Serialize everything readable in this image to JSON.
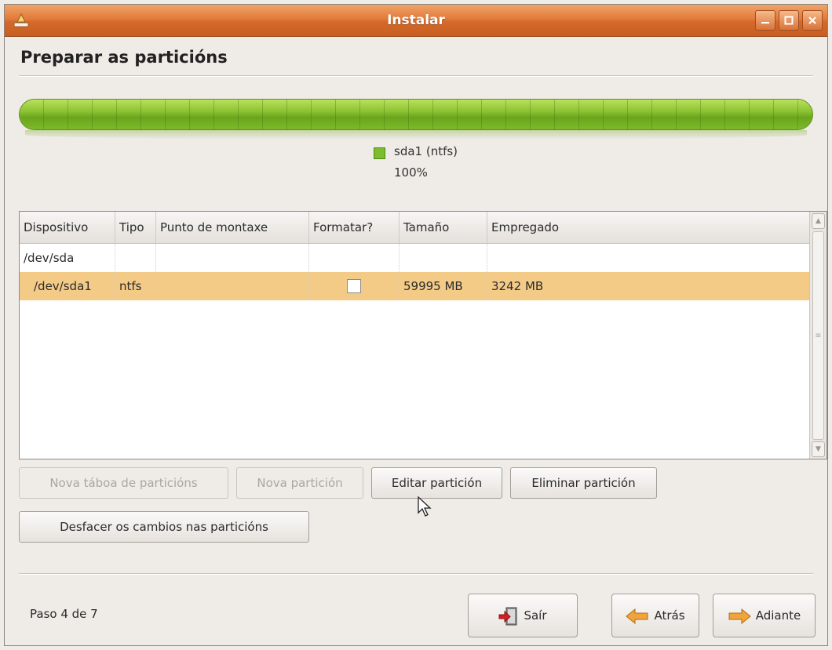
{
  "window": {
    "title": "Instalar",
    "controls": [
      "minimize",
      "maximize",
      "close"
    ],
    "accent_color": "#e27a3a"
  },
  "page": {
    "title": "Preparar as particións"
  },
  "partition_bar": {
    "fill_fraction": 1.0,
    "fill_color": "#7cbd2f",
    "legend": {
      "name": "sda1 (ntfs)",
      "percent": "100%"
    }
  },
  "table": {
    "columns": [
      "Dispositivo",
      "Tipo",
      "Punto de montaxe",
      "Formatar?",
      "Tamaño",
      "Empregado"
    ],
    "rows": [
      {
        "device": "/dev/sda",
        "type": "",
        "mount": "",
        "format": null,
        "size": "",
        "used": "",
        "selected": false
      },
      {
        "device": "/dev/sda1",
        "type": "ntfs",
        "mount": "",
        "format": false,
        "size": "59995 MB",
        "used": "3242 MB",
        "selected": true
      }
    ],
    "selection_color": "#f3ca86"
  },
  "actions": {
    "new_table": "Nova táboa de particións",
    "new_partition": "Nova partición",
    "edit_partition": "Editar partición",
    "delete_partition": "Eliminar partición",
    "undo_changes": "Desfacer os cambios nas particións"
  },
  "footer": {
    "step": "Paso 4 de 7",
    "quit": "Saír",
    "back": "Atrás",
    "forward": "Adiante"
  },
  "icons": {
    "app": "installer-icon",
    "quit": "exit-door-icon",
    "back": "arrow-left-icon",
    "forward": "arrow-right-icon"
  }
}
